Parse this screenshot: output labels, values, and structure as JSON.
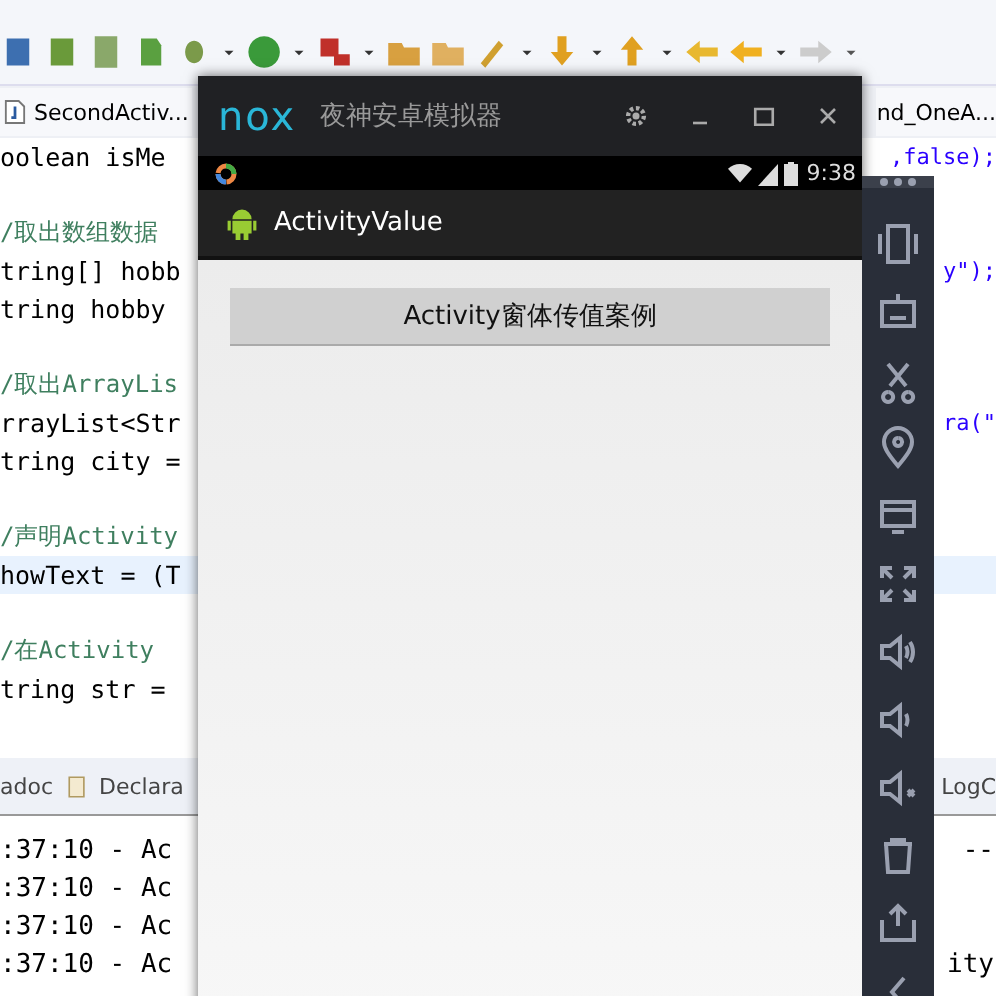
{
  "editor_tabs": [
    {
      "label": "SecondActiv..."
    },
    {
      "label": "nd_OneA..."
    }
  ],
  "code_lines": [
    {
      "kind": "code",
      "text": "oolean isMe",
      "tail": ",false);",
      "highlighted": false
    },
    {
      "kind": "blank",
      "highlighted": false
    },
    {
      "kind": "comment",
      "text": "/取出数组数据",
      "highlighted": false
    },
    {
      "kind": "code",
      "text": "tring[] hobb",
      "tail": "y\");",
      "highlighted": false
    },
    {
      "kind": "code",
      "text": "tring hobby",
      "highlighted": false
    },
    {
      "kind": "blank",
      "highlighted": false
    },
    {
      "kind": "comment",
      "text": "/取出ArrayLis",
      "highlighted": false
    },
    {
      "kind": "code",
      "text": "rrayList<Str",
      "tail": "ra(\"",
      "highlighted": false
    },
    {
      "kind": "code",
      "text": "tring city =",
      "highlighted": false
    },
    {
      "kind": "blank",
      "highlighted": false
    },
    {
      "kind": "comment",
      "text": "/声明Activity",
      "highlighted": false
    },
    {
      "kind": "code",
      "text": "howText = (T",
      "highlighted": true
    },
    {
      "kind": "blank",
      "highlighted": false
    },
    {
      "kind": "comment",
      "text": "/在Activity",
      "highlighted": false
    },
    {
      "kind": "code",
      "text": "tring str =",
      "highlighted": false
    }
  ],
  "panel_tabs": {
    "left": [
      "adoc",
      "Declara"
    ],
    "right": "LogC"
  },
  "console_lines": [
    {
      "text": ":37:10 - Ac",
      "tail": "--"
    },
    {
      "text": ":37:10 - Ac"
    },
    {
      "text": ":37:10 - Ac"
    },
    {
      "text": ":37:10 - Ac",
      "tail": "ity"
    }
  ],
  "emulator": {
    "logo": "nox",
    "title": "夜神安卓模拟器",
    "time": "9:38",
    "app_title": "ActivityValue",
    "button": "Activity窗体传值案例"
  }
}
